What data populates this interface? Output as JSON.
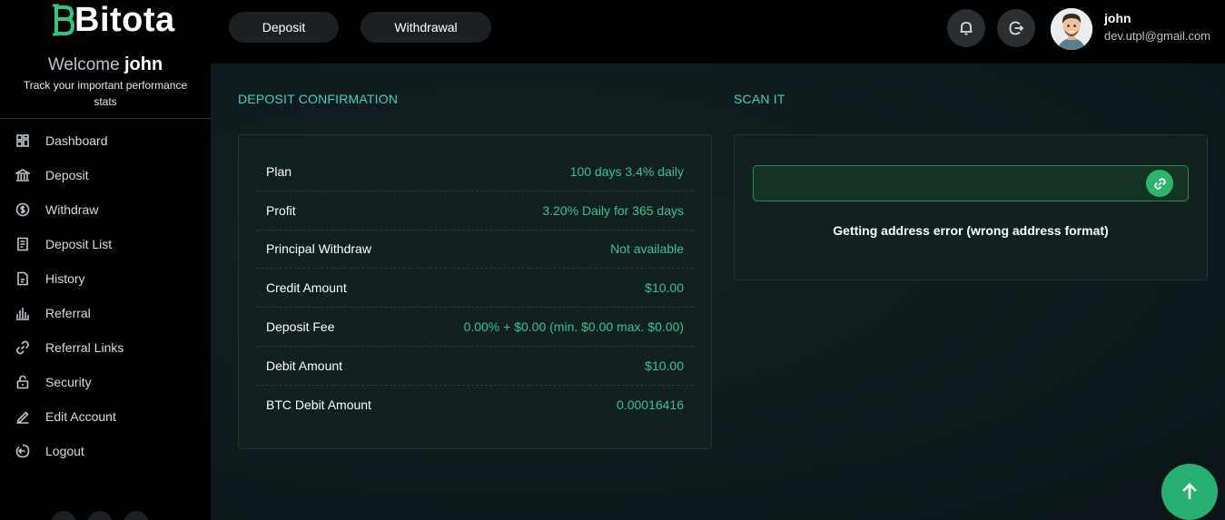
{
  "brand": {
    "name": "Bitota",
    "accent": "#27b071"
  },
  "sidebar": {
    "welcome_prefix": "Welcome",
    "welcome_user": "john",
    "tagline": "Track your important performance stats",
    "items": [
      {
        "label": "Dashboard",
        "icon": "dashboard-icon"
      },
      {
        "label": "Deposit",
        "icon": "bank-icon"
      },
      {
        "label": "Withdraw",
        "icon": "dollar-icon"
      },
      {
        "label": "Deposit List",
        "icon": "list-icon"
      },
      {
        "label": "History",
        "icon": "document-icon"
      },
      {
        "label": "Referral",
        "icon": "bar-chart-icon"
      },
      {
        "label": "Referral Links",
        "icon": "link-icon"
      },
      {
        "label": "Security",
        "icon": "lock-icon"
      },
      {
        "label": "Edit Account",
        "icon": "edit-icon"
      },
      {
        "label": "Logout",
        "icon": "logout-icon"
      }
    ]
  },
  "topbar": {
    "deposit_label": "Deposit",
    "withdrawal_label": "Withdrawal",
    "user_name": "john",
    "user_email": "dev.utpl@gmail.com"
  },
  "deposit": {
    "title": "DEPOSIT CONFIRMATION",
    "rows": [
      {
        "label": "Plan",
        "value": "100 days 3.4% daily"
      },
      {
        "label": "Profit",
        "value": "3.20% Daily for 365 days"
      },
      {
        "label": "Principal Withdraw",
        "value": "Not available"
      },
      {
        "label": "Credit Amount",
        "value": "$10.00"
      },
      {
        "label": "Deposit Fee",
        "value": "0.00% + $0.00 (min. $0.00 max. $0.00)"
      },
      {
        "label": "Debit Amount",
        "value": "$10.00"
      },
      {
        "label": "BTC Debit Amount",
        "value": "0.00016416"
      }
    ]
  },
  "scan": {
    "title": "SCAN IT",
    "address_value": "",
    "error": "Getting address error (wrong address format)"
  }
}
